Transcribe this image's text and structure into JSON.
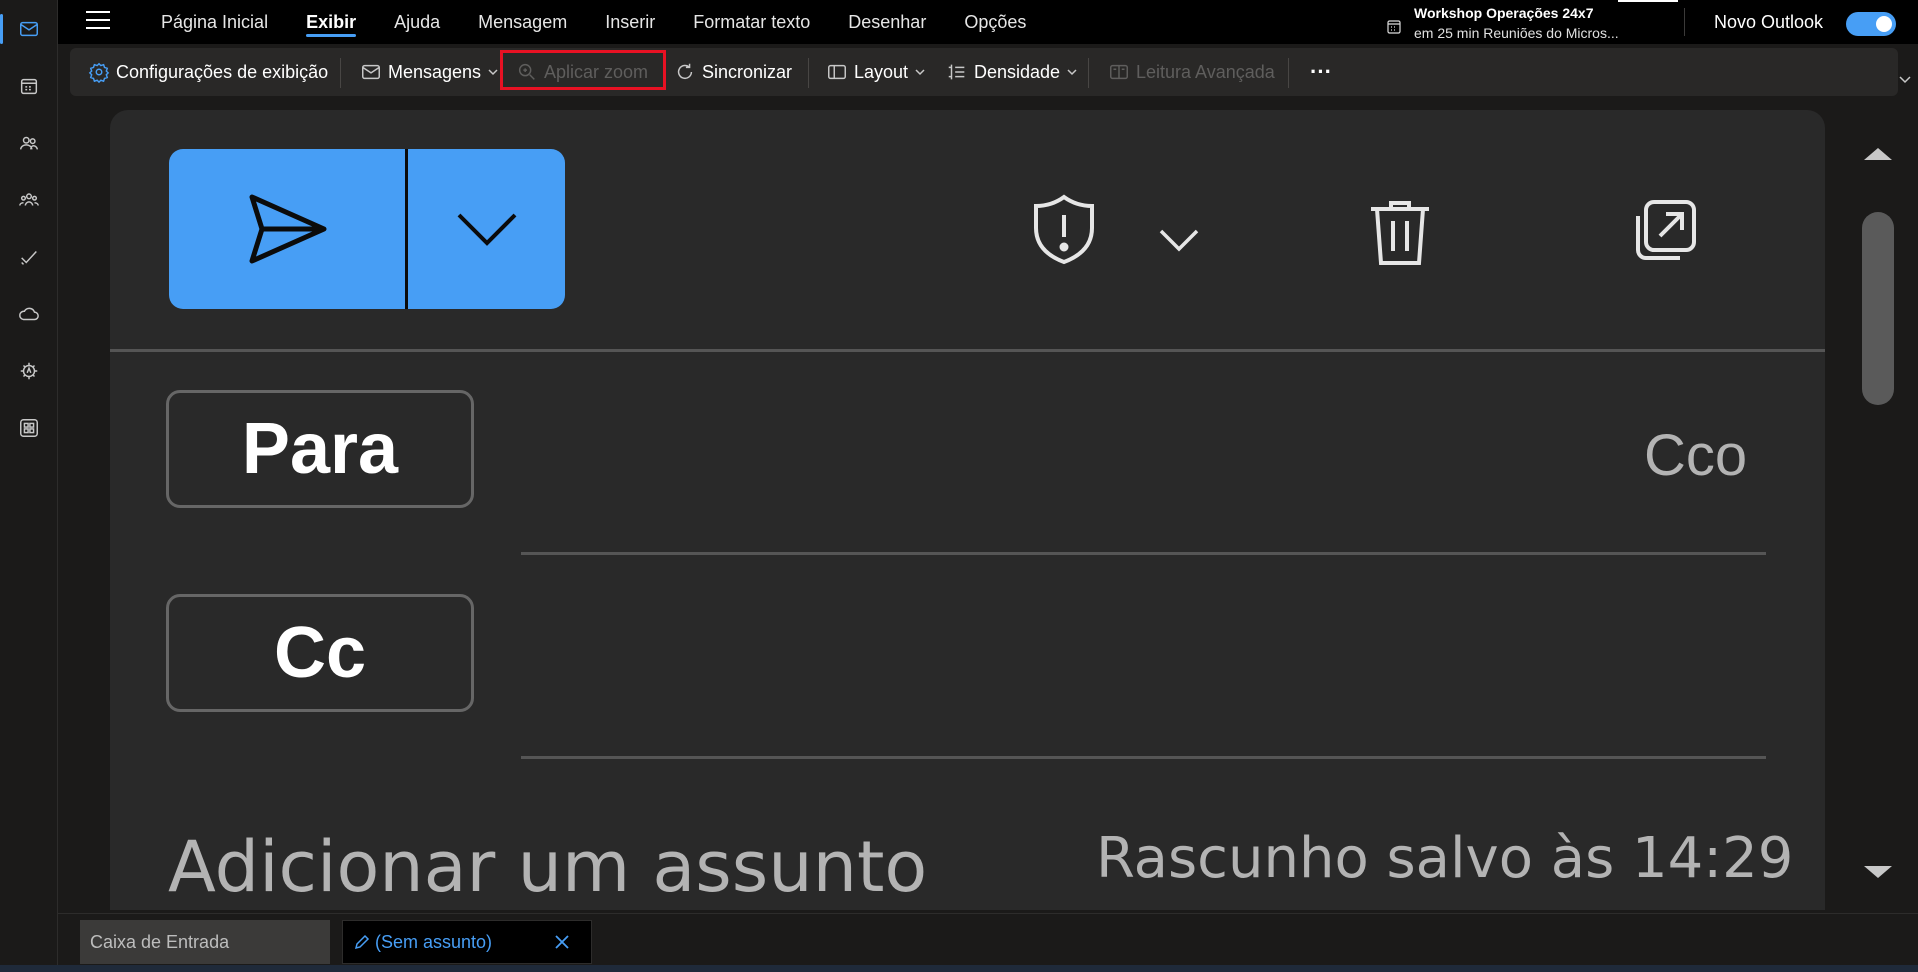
{
  "rail": {
    "items": [
      {
        "name": "mail-icon",
        "active": true
      },
      {
        "name": "calendar-icon"
      },
      {
        "name": "people-icon"
      },
      {
        "name": "groups-icon"
      },
      {
        "name": "todo-icon"
      },
      {
        "name": "onedrive-icon"
      },
      {
        "name": "copilot-icon"
      },
      {
        "name": "apps-icon"
      }
    ]
  },
  "menu": {
    "tabs": [
      "Página Inicial",
      "Exibir",
      "Ajuda",
      "Mensagem",
      "Inserir",
      "Formatar texto",
      "Desenhar",
      "Opções"
    ],
    "active": "Exibir"
  },
  "reminder": {
    "title": "Workshop Operações 24x7",
    "subtitle": "em 25 min Reuniões do Micros..."
  },
  "novo_outlook": {
    "label": "Novo Outlook",
    "enabled": true
  },
  "ribbon": {
    "view_settings": "Configurações de exibição",
    "messages": "Mensagens",
    "zoom": "Aplicar zoom",
    "sync": "Sincronizar",
    "layout": "Layout",
    "density": "Densidade",
    "immersive": "Leitura Avançada",
    "more": "···"
  },
  "compose": {
    "to_label": "Para",
    "cc_label": "Cc",
    "bcc_label": "Cco",
    "subject_placeholder": "Adicionar um assunto",
    "draft_status": "Rascunho salvo às 14:29"
  },
  "bottom_tabs": {
    "inbox": "Caixa de Entrada",
    "draft": "(Sem assunto)"
  },
  "colors": {
    "accent": "#479ef5",
    "highlight_border": "#e81123"
  }
}
